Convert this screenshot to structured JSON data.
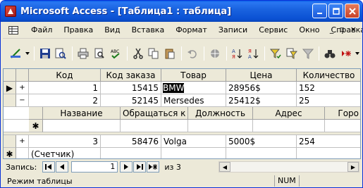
{
  "window": {
    "title": "Microsoft Access - [Таблица1 : таблица]"
  },
  "menu": {
    "items": [
      "Файл",
      "Правка",
      "Вид",
      "Вставка",
      "Формат",
      "Записи",
      "Сервис",
      "Окно",
      "Справка"
    ],
    "right_controls": [
      "_",
      "▫",
      "×"
    ]
  },
  "grid": {
    "columns": [
      "Код",
      "Код заказа",
      "Товар",
      "Цена",
      "Количество"
    ],
    "rows": [
      {
        "expander": "+",
        "selector": "▶",
        "code": "1",
        "order_code": "15415",
        "product": "BMW",
        "price": "28956$",
        "qty": "152"
      },
      {
        "expander": "−",
        "selector": "",
        "code": "2",
        "order_code": "52145",
        "product": "Mersedes",
        "price": "25412$",
        "qty": "25"
      },
      {
        "expander": "+",
        "selector": "",
        "code": "3",
        "order_code": "58476",
        "product": "Volga",
        "price": "5000$",
        "qty": "254"
      }
    ],
    "subgrid": {
      "columns": [
        "Название",
        "Обращаться к",
        "Должность",
        "Адрес",
        "Горо"
      ],
      "new_row_marker": "✱"
    },
    "new_row": {
      "selector": "✱",
      "code": "(Счетчик)"
    }
  },
  "nav": {
    "label": "Запись:",
    "current": "1",
    "of_label": "из  3"
  },
  "status": {
    "text": "Режим таблицы",
    "num": "NUM"
  }
}
